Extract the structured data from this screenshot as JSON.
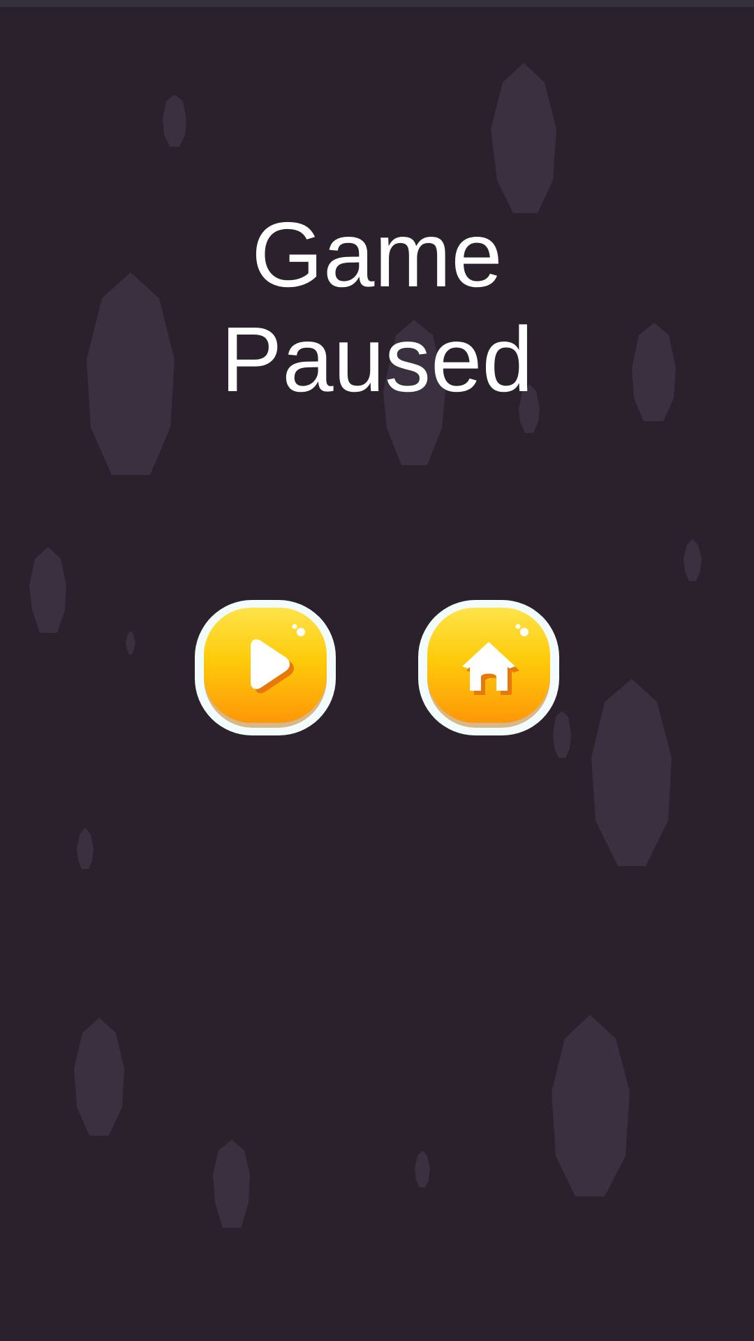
{
  "screen": {
    "title_line_1": "Game",
    "title_line_2": "Paused"
  },
  "buttons": {
    "resume": {
      "icon": "play-icon"
    },
    "home": {
      "icon": "home-icon"
    }
  },
  "colors": {
    "background": "#2a212c",
    "rock": "#3a303f",
    "button_yellow": "#ffd21a",
    "button_orange": "#ff9a0a",
    "button_rim": "#f2fcfc",
    "icon_white": "#ffffff",
    "icon_shadow": "#e8780a"
  }
}
